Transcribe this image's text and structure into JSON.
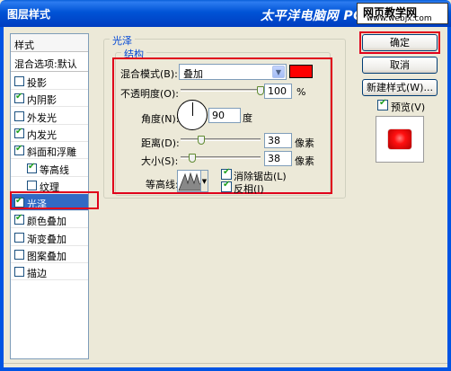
{
  "window": {
    "title": "图层样式",
    "watermark": "太平洋电脑网 PCon",
    "badge_line1": "网页教学网",
    "badge_line2": "www.webjx.com"
  },
  "styles_panel": {
    "header": "样式",
    "blend_options": "混合选项:默认",
    "items": [
      {
        "label": "投影",
        "checked": false,
        "indent": false
      },
      {
        "label": "内阴影",
        "checked": true,
        "indent": false
      },
      {
        "label": "外发光",
        "checked": false,
        "indent": false
      },
      {
        "label": "内发光",
        "checked": true,
        "indent": false
      },
      {
        "label": "斜面和浮雕",
        "checked": true,
        "indent": false
      },
      {
        "label": "等高线",
        "checked": true,
        "indent": true
      },
      {
        "label": "纹理",
        "checked": false,
        "indent": true
      },
      {
        "label": "光泽",
        "checked": true,
        "indent": false,
        "selected": true
      },
      {
        "label": "颜色叠加",
        "checked": true,
        "indent": false
      },
      {
        "label": "渐变叠加",
        "checked": false,
        "indent": false
      },
      {
        "label": "图案叠加",
        "checked": false,
        "indent": false
      },
      {
        "label": "描边",
        "checked": false,
        "indent": false
      }
    ]
  },
  "satin": {
    "group_title": "光泽",
    "structure_title": "结构",
    "blend_mode_label": "混合模式(B):",
    "blend_mode_value": "叠加",
    "color": "#ff0000",
    "opacity_label": "不透明度(O):",
    "opacity_value": "100",
    "opacity_unit": "%",
    "opacity_level": 1.0,
    "angle_label": "角度(N):",
    "angle_value": "90",
    "angle_unit": "度",
    "distance_label": "距离(D):",
    "distance_value": "38",
    "distance_unit": "像素",
    "distance_level": 0.26,
    "size_label": "大小(S):",
    "size_value": "38",
    "size_unit": "像素",
    "size_level": 0.15,
    "contour_label": "等高线:",
    "antialias_label": "消除锯齿(L)",
    "antialias_checked": true,
    "invert_label": "反相(I)",
    "invert_checked": true
  },
  "buttons": {
    "ok": "确定",
    "cancel": "取消",
    "new_style": "新建样式(W)...",
    "preview_label": "预览(V)",
    "preview_checked": true
  },
  "colors": {
    "highlight": "#e0001b",
    "selection": "#316ac5",
    "accent": "#0046d5"
  }
}
